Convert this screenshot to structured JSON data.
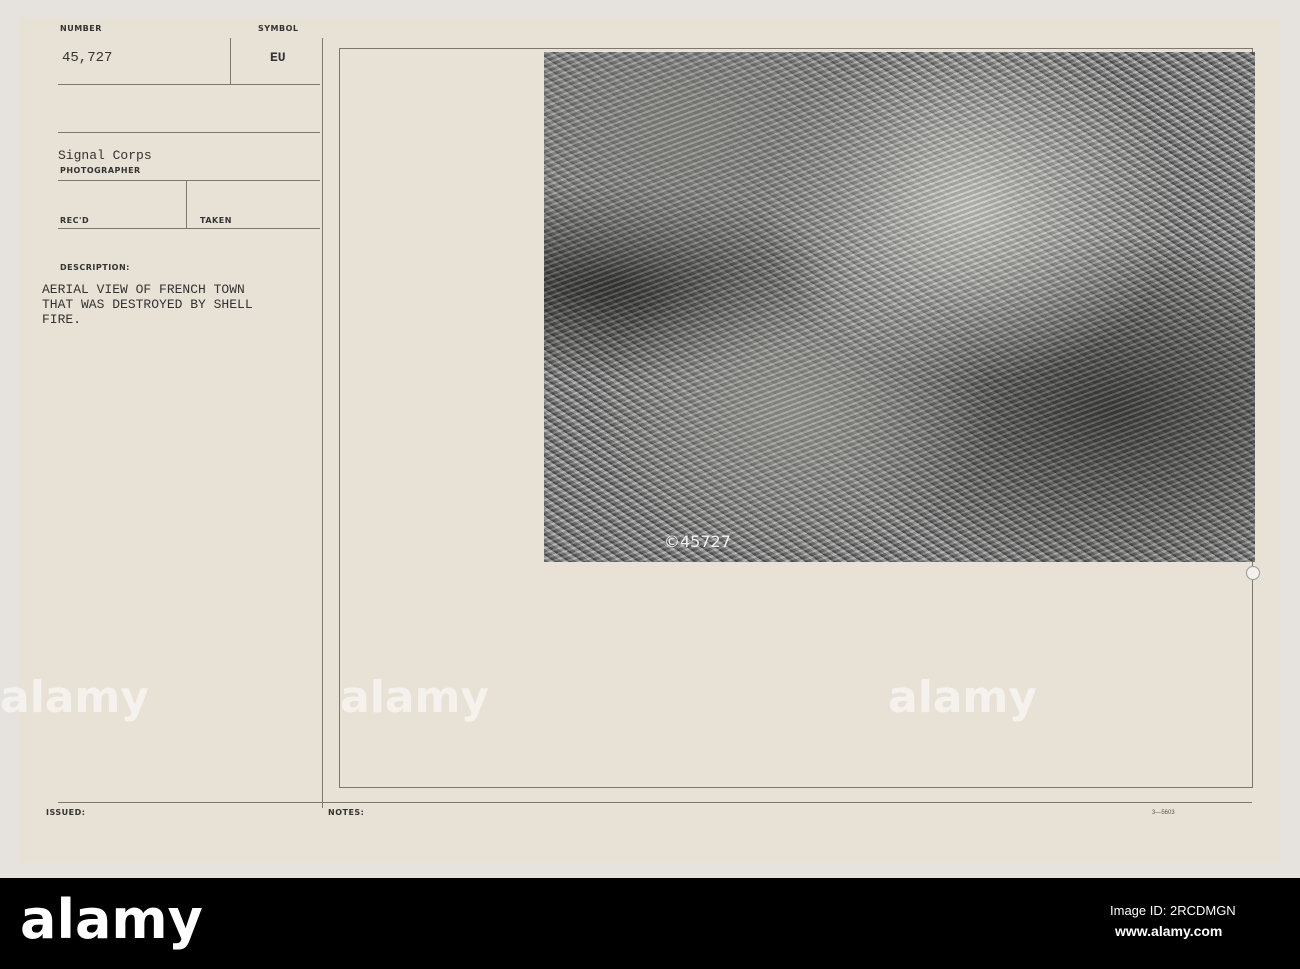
{
  "card": {
    "number_label": "NUMBER",
    "number": "45,727",
    "symbol_label": "SYMBOL",
    "symbol": "EU",
    "photographer": "Signal Corps",
    "photographer_label": "PHOTOGRAPHER",
    "recd_label": "REC'D",
    "taken_label": "TAKEN",
    "description_label": "DESCRIPTION:",
    "description_lines": [
      "AERIAL VIEW OF FRENCH TOWN",
      "THAT WAS DESTROYED BY SHELL",
      "FIRE."
    ],
    "issued_label": "ISSUED:",
    "notes_label": "NOTES:",
    "form_number": "3—5603",
    "negative_number": "©45727"
  },
  "watermark": {
    "text": "alamy"
  },
  "footer": {
    "brand": "alamy",
    "image_id": "Image ID: 2RCDMGN",
    "url": "www.alamy.com"
  }
}
